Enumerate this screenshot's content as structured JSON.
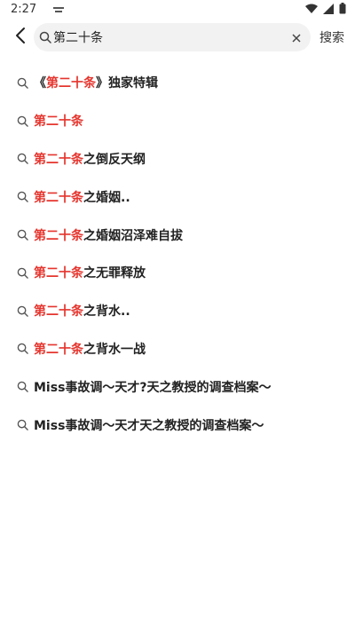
{
  "status": {
    "time": "2:27"
  },
  "search": {
    "query": "第二十条",
    "submit_label": "搜索"
  },
  "suggestions": [
    {
      "pre": "《",
      "match": "第二十条",
      "post": "》独家特辑"
    },
    {
      "pre": "",
      "match": "第二十条",
      "post": ""
    },
    {
      "pre": "",
      "match": "第二十条",
      "post": "之倒反天纲"
    },
    {
      "pre": "",
      "match": "第二十条",
      "post": "之婚姻.."
    },
    {
      "pre": "",
      "match": "第二十条",
      "post": "之婚姻沼泽难自拔"
    },
    {
      "pre": "",
      "match": "第二十条",
      "post": "之无罪释放"
    },
    {
      "pre": "",
      "match": "第二十条",
      "post": "之背水.."
    },
    {
      "pre": "",
      "match": "第二十条",
      "post": "之背水一战"
    },
    {
      "pre": "Miss事故调～天才?天之教授的调查档案～",
      "match": "",
      "post": ""
    },
    {
      "pre": "Miss事故调～天才天之教授的调查档案～",
      "match": "",
      "post": ""
    }
  ],
  "colors": {
    "highlight": "#e5352e",
    "search_bg": "#f2f2f2"
  },
  "icons": [
    "back-arrow-icon",
    "search-icon",
    "clear-icon",
    "wifi-icon",
    "cellular-icon",
    "battery-icon",
    "notification-icon"
  ]
}
